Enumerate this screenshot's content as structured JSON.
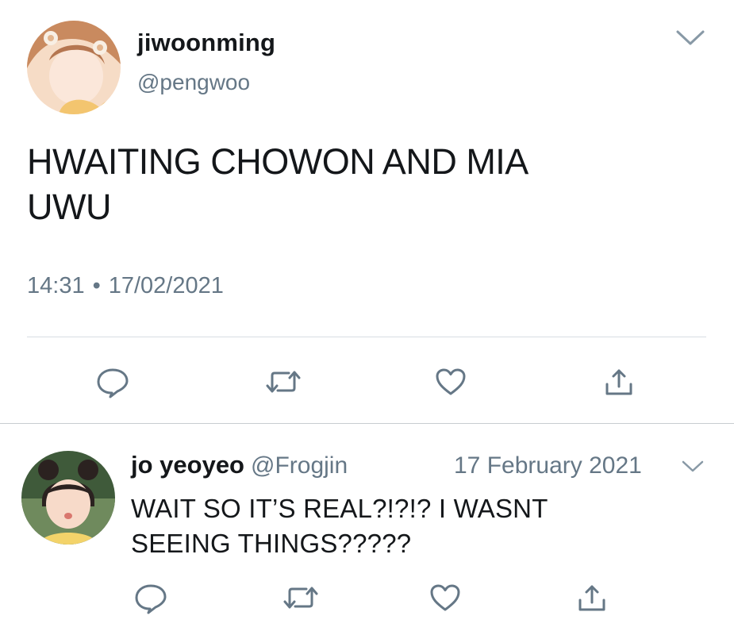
{
  "main_tweet": {
    "display_name": "jiwoonming",
    "handle": "@pengwoo",
    "text": "HWAITING CHOWON AND MIA\nUWU",
    "time": "14:31",
    "separator": "•",
    "date": "17/02/2021",
    "actions": [
      "reply-icon",
      "retweet-icon",
      "like-icon",
      "share-icon"
    ]
  },
  "reply_tweet": {
    "display_name": "jo yeoyeo",
    "handle": "@Frogjin",
    "date": "17 February 2021",
    "text": "WAIT SO IT’S REAL?!?!? I WASNT\nSEEING THINGS?????",
    "actions": [
      "reply-icon",
      "retweet-icon",
      "like-icon",
      "share-icon"
    ]
  },
  "colors": {
    "text_primary": "#14171a",
    "text_secondary": "#657786",
    "icon": "#657786",
    "divider": "#d7dde2"
  }
}
